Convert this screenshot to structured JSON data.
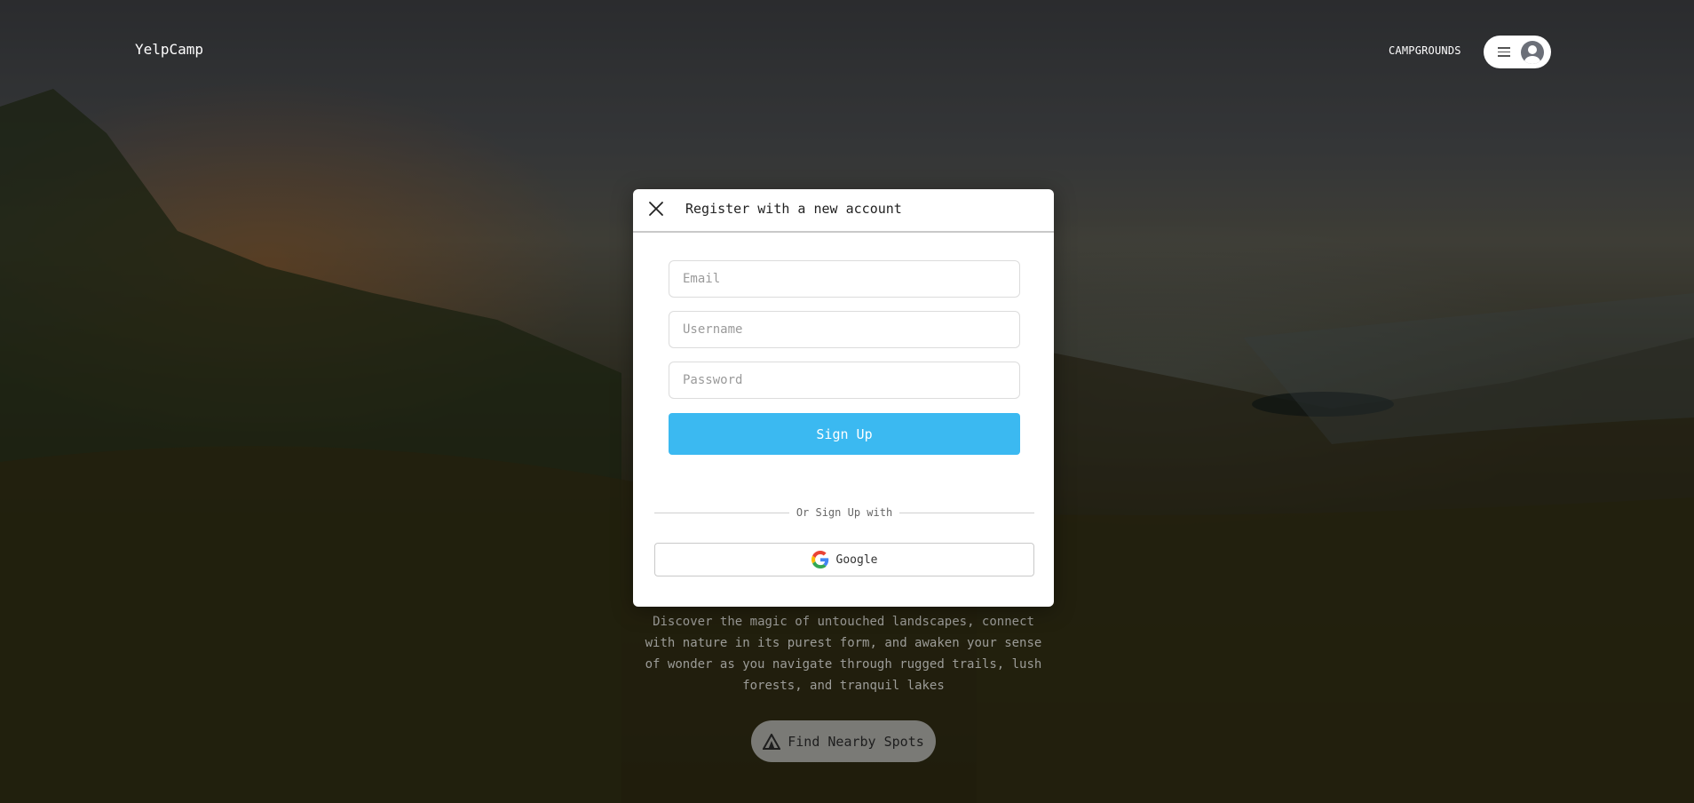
{
  "nav": {
    "logo": "YelpCamp",
    "campgrounds_link": "CAMPGROUNDS"
  },
  "modal": {
    "title": "Register with a new account",
    "email_placeholder": "Email",
    "username_placeholder": "Username",
    "password_placeholder": "Password",
    "signup_label": "Sign Up",
    "divider_text": "Or Sign Up with",
    "google_label": "Google"
  },
  "hero": {
    "description": "Discover the magic of untouched landscapes, connect with nature in its purest form, and awaken your sense of wonder as you navigate through rugged trails, lush forests, and tranquil lakes",
    "cta_label": "Find Nearby Spots"
  },
  "colors": {
    "primary": "#3bb9f1",
    "overlay": "rgba(0,0,0,0.42)"
  },
  "icons": [
    "close-icon",
    "hamburger-icon",
    "user-avatar-icon",
    "google-icon",
    "tent-icon"
  ]
}
